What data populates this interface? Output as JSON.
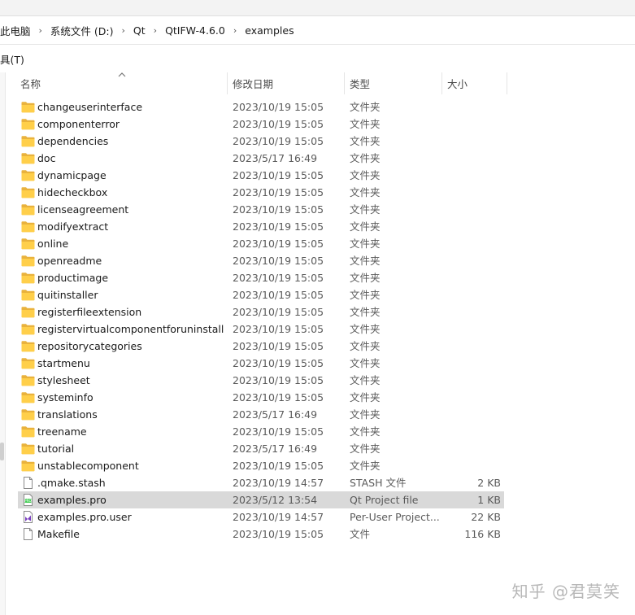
{
  "breadcrumb": {
    "items": [
      "此电脑",
      "系统文件 (D:)",
      "Qt",
      "QtIFW-4.6.0",
      "examples"
    ],
    "separator": "›"
  },
  "menubar": {
    "tools_label": "具(T)"
  },
  "columns": {
    "name": "名称",
    "date": "修改日期",
    "type": "类型",
    "size": "大小"
  },
  "files": [
    {
      "name": "changeuserinterface",
      "date": "2023/10/19 15:05",
      "type": "文件夹",
      "size": "",
      "icon": "folder-icon"
    },
    {
      "name": "componenterror",
      "date": "2023/10/19 15:05",
      "type": "文件夹",
      "size": "",
      "icon": "folder-icon"
    },
    {
      "name": "dependencies",
      "date": "2023/10/19 15:05",
      "type": "文件夹",
      "size": "",
      "icon": "folder-icon"
    },
    {
      "name": "doc",
      "date": "2023/5/17 16:49",
      "type": "文件夹",
      "size": "",
      "icon": "folder-icon"
    },
    {
      "name": "dynamicpage",
      "date": "2023/10/19 15:05",
      "type": "文件夹",
      "size": "",
      "icon": "folder-icon"
    },
    {
      "name": "hidecheckbox",
      "date": "2023/10/19 15:05",
      "type": "文件夹",
      "size": "",
      "icon": "folder-icon"
    },
    {
      "name": "licenseagreement",
      "date": "2023/10/19 15:05",
      "type": "文件夹",
      "size": "",
      "icon": "folder-icon"
    },
    {
      "name": "modifyextract",
      "date": "2023/10/19 15:05",
      "type": "文件夹",
      "size": "",
      "icon": "folder-icon"
    },
    {
      "name": "online",
      "date": "2023/10/19 15:05",
      "type": "文件夹",
      "size": "",
      "icon": "folder-icon"
    },
    {
      "name": "openreadme",
      "date": "2023/10/19 15:05",
      "type": "文件夹",
      "size": "",
      "icon": "folder-icon"
    },
    {
      "name": "productimage",
      "date": "2023/10/19 15:05",
      "type": "文件夹",
      "size": "",
      "icon": "folder-icon"
    },
    {
      "name": "quitinstaller",
      "date": "2023/10/19 15:05",
      "type": "文件夹",
      "size": "",
      "icon": "folder-icon"
    },
    {
      "name": "registerfileextension",
      "date": "2023/10/19 15:05",
      "type": "文件夹",
      "size": "",
      "icon": "folder-icon"
    },
    {
      "name": "registervirtualcomponentforuninstall",
      "date": "2023/10/19 15:05",
      "type": "文件夹",
      "size": "",
      "icon": "folder-icon"
    },
    {
      "name": "repositorycategories",
      "date": "2023/10/19 15:05",
      "type": "文件夹",
      "size": "",
      "icon": "folder-icon"
    },
    {
      "name": "startmenu",
      "date": "2023/10/19 15:05",
      "type": "文件夹",
      "size": "",
      "icon": "folder-icon"
    },
    {
      "name": "stylesheet",
      "date": "2023/10/19 15:05",
      "type": "文件夹",
      "size": "",
      "icon": "folder-icon"
    },
    {
      "name": "systeminfo",
      "date": "2023/10/19 15:05",
      "type": "文件夹",
      "size": "",
      "icon": "folder-icon"
    },
    {
      "name": "translations",
      "date": "2023/5/17 16:49",
      "type": "文件夹",
      "size": "",
      "icon": "folder-icon"
    },
    {
      "name": "treename",
      "date": "2023/10/19 15:05",
      "type": "文件夹",
      "size": "",
      "icon": "folder-icon"
    },
    {
      "name": "tutorial",
      "date": "2023/5/17 16:49",
      "type": "文件夹",
      "size": "",
      "icon": "folder-icon"
    },
    {
      "name": "unstablecomponent",
      "date": "2023/10/19 15:05",
      "type": "文件夹",
      "size": "",
      "icon": "folder-icon"
    },
    {
      "name": ".qmake.stash",
      "date": "2023/10/19 14:57",
      "type": "STASH 文件",
      "size": "2 KB",
      "icon": "file-icon"
    },
    {
      "name": "examples.pro",
      "date": "2023/5/12 13:54",
      "type": "Qt Project file",
      "size": "1 KB",
      "icon": "qt-pro-file-icon",
      "selected": true
    },
    {
      "name": "examples.pro.user",
      "date": "2023/10/19 14:57",
      "type": "Per-User Project...",
      "size": "22 KB",
      "icon": "visual-studio-file-icon"
    },
    {
      "name": "Makefile",
      "date": "2023/10/19 15:05",
      "type": "文件",
      "size": "116 KB",
      "icon": "file-icon"
    }
  ],
  "watermark": "知乎 @君莫笑"
}
